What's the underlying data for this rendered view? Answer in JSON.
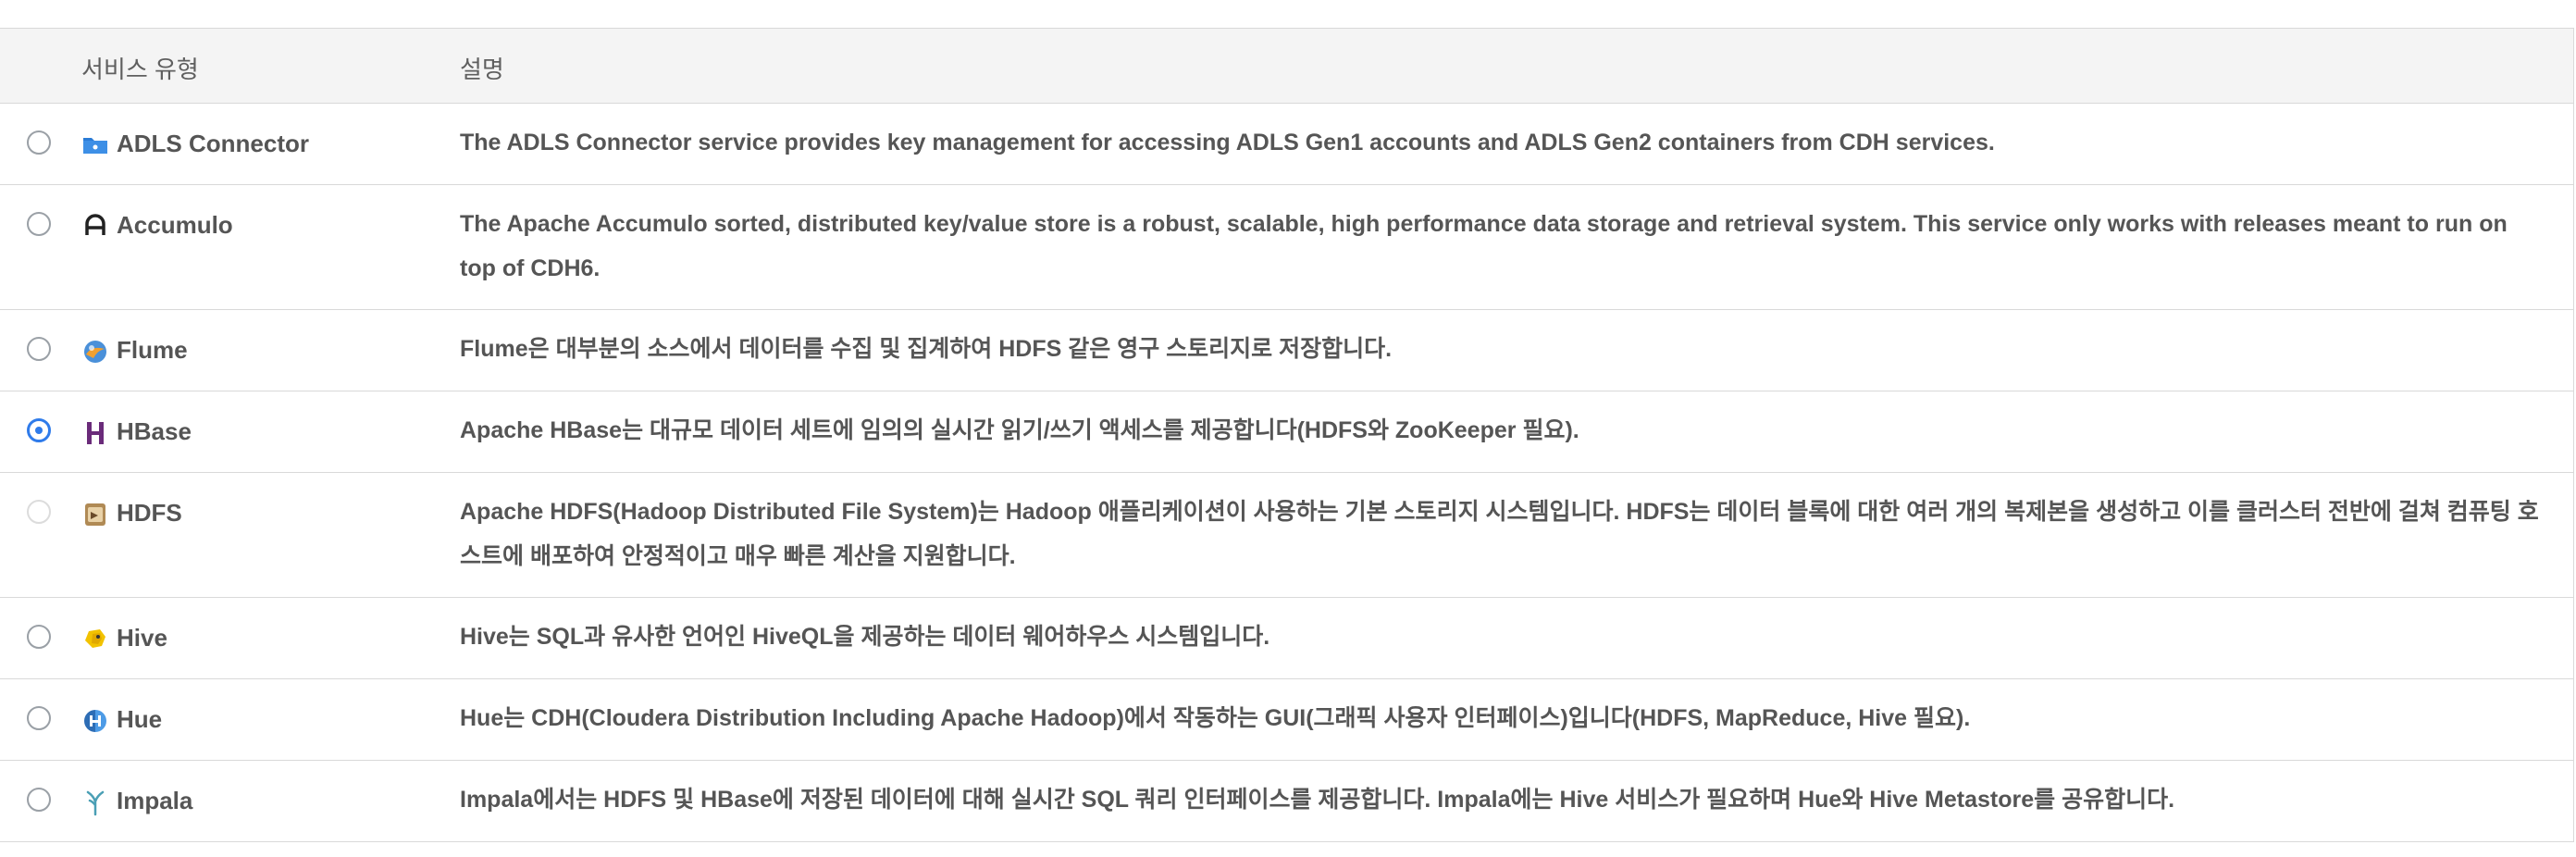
{
  "table": {
    "headers": {
      "service_type": "서비스 유형",
      "description": "설명"
    },
    "rows": [
      {
        "name": "ADLS Connector",
        "icon": "folder-icon",
        "selected": false,
        "disabled": false,
        "description": "The ADLS Connector service provides key management for accessing ADLS Gen1 accounts and ADLS Gen2 containers from CDH services."
      },
      {
        "name": "Accumulo",
        "icon": "accumulo-icon",
        "selected": false,
        "disabled": false,
        "description": "The Apache Accumulo sorted, distributed key/value store is a robust, scalable, high performance data storage and retrieval system. This service only works with releases meant to run on top of CDH6."
      },
      {
        "name": "Flume",
        "icon": "flume-icon",
        "selected": false,
        "disabled": false,
        "description": "Flume은 대부분의 소스에서 데이터를 수집 및 집계하여 HDFS 같은 영구 스토리지로 저장합니다."
      },
      {
        "name": "HBase",
        "icon": "hbase-icon",
        "selected": true,
        "disabled": false,
        "description": "Apache HBase는 대규모 데이터 세트에 임의의 실시간 읽기/쓰기 액세스를 제공합니다(HDFS와 ZooKeeper 필요)."
      },
      {
        "name": "HDFS",
        "icon": "hdfs-icon",
        "selected": false,
        "disabled": true,
        "description": "Apache HDFS(Hadoop Distributed File System)는 Hadoop 애플리케이션이 사용하는 기본 스토리지 시스템입니다. HDFS는 데이터 블록에 대한 여러 개의 복제본을 생성하고 이를 클러스터 전반에 걸쳐 컴퓨팅 호스트에 배포하여 안정적이고 매우 빠른 계산을 지원합니다."
      },
      {
        "name": "Hive",
        "icon": "hive-icon",
        "selected": false,
        "disabled": false,
        "description": "Hive는 SQL과 유사한 언어인 HiveQL을 제공하는 데이터 웨어하우스 시스템입니다."
      },
      {
        "name": "Hue",
        "icon": "hue-icon",
        "selected": false,
        "disabled": false,
        "description": "Hue는 CDH(Cloudera Distribution Including Apache Hadoop)에서 작동하는 GUI(그래픽 사용자 인터페이스)입니다(HDFS, MapReduce, Hive 필요)."
      },
      {
        "name": "Impala",
        "icon": "impala-icon",
        "selected": false,
        "disabled": false,
        "description": "Impala에서는 HDFS 및 HBase에 저장된 데이터에 대해 실시간 SQL 쿼리 인터페이스를 제공합니다. Impala에는 Hive 서비스가 필요하며 Hue와 Hive Metastore를 공유합니다."
      }
    ]
  },
  "colors": {
    "accent": "#2f7bea",
    "border": "#d9d9d9",
    "header_bg": "#f4f4f4",
    "text": "#555555"
  }
}
